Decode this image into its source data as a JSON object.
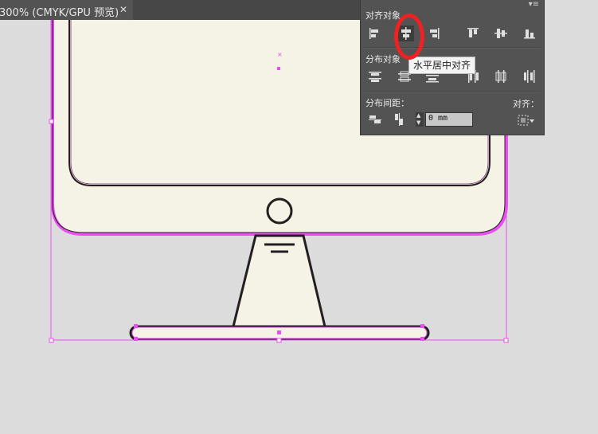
{
  "document_tab": {
    "title": "300% (CMYK/GPU 预览)",
    "close_glyph": "✕"
  },
  "artwork": {
    "subject": "monitor-illustration",
    "fill_color": "#f5f2e6",
    "stroke_color": "#231f20",
    "selection_color": "#e84ef0"
  },
  "align_panel": {
    "menu_glyph": "▾≡",
    "align_objects_title": "对齐对象",
    "distribute_objects_title": "分布对象",
    "distribute_spacing_title": "分布间距：",
    "align_to_title": "对齐：",
    "spacing_value": "0 mm",
    "align_objects_buttons": [
      {
        "name": "horizontal-align-left",
        "icon": "align-left-icon"
      },
      {
        "name": "horizontal-align-center",
        "icon": "align-hcenter-icon"
      },
      {
        "name": "horizontal-align-right",
        "icon": "align-right-icon"
      },
      {
        "name": "vertical-align-top",
        "icon": "align-top-icon"
      },
      {
        "name": "vertical-align-center",
        "icon": "align-vcenter-icon"
      },
      {
        "name": "vertical-align-bottom",
        "icon": "align-bottom-icon"
      }
    ],
    "distribute_objects_buttons": [
      {
        "name": "vertical-distribute-top",
        "icon": "distribute-top-icon"
      },
      {
        "name": "vertical-distribute-center",
        "icon": "distribute-vcenter-icon"
      },
      {
        "name": "vertical-distribute-bottom",
        "icon": "distribute-bottom-icon"
      },
      {
        "name": "horizontal-distribute-left",
        "icon": "distribute-left-icon"
      },
      {
        "name": "horizontal-distribute-center",
        "icon": "distribute-hcenter-icon"
      },
      {
        "name": "horizontal-distribute-right",
        "icon": "distribute-right-icon"
      }
    ]
  },
  "tooltip": {
    "text": "水平居中对齐"
  },
  "annotation": {
    "color": "#ee2222",
    "target": "horizontal-align-center"
  }
}
